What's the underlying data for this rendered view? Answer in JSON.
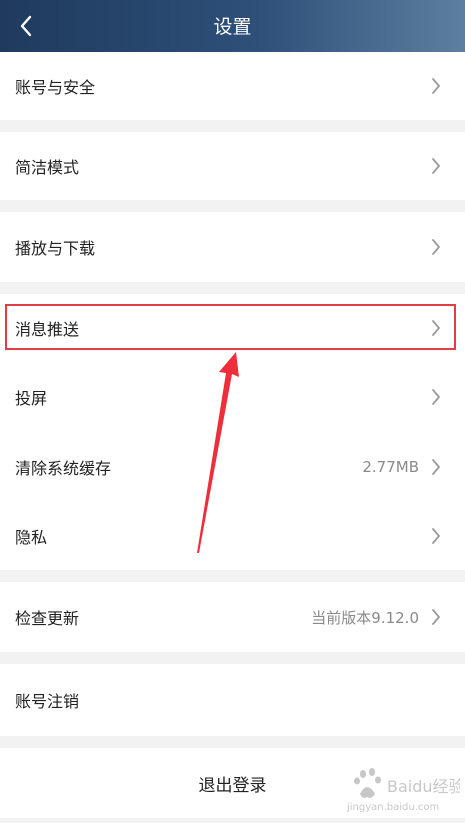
{
  "header": {
    "title": "设置",
    "back_icon": "chevron-left-icon"
  },
  "settings": {
    "account_security": "账号与安全",
    "simple_mode": "简洁模式",
    "play_download": "播放与下载",
    "push_notifications": "消息推送",
    "cast_screen": "投屏",
    "clear_cache": "清除系统缓存",
    "cache_size": "2.77MB",
    "privacy": "隐私",
    "check_update": "检查更新",
    "current_version": "当前版本9.12.0",
    "deactivate_account": "账号注销",
    "logout": "退出登录"
  },
  "annotation": {
    "highlight_color": "#e23c44",
    "target": "消息推送"
  },
  "watermark": {
    "text": "Baidu经验",
    "url": "jingyan.baidu.com"
  },
  "colors": {
    "header_start": "#1f3a5d",
    "header_end": "#5d7fa0",
    "background": "#f2f2f2",
    "row_bg": "#ffffff"
  }
}
